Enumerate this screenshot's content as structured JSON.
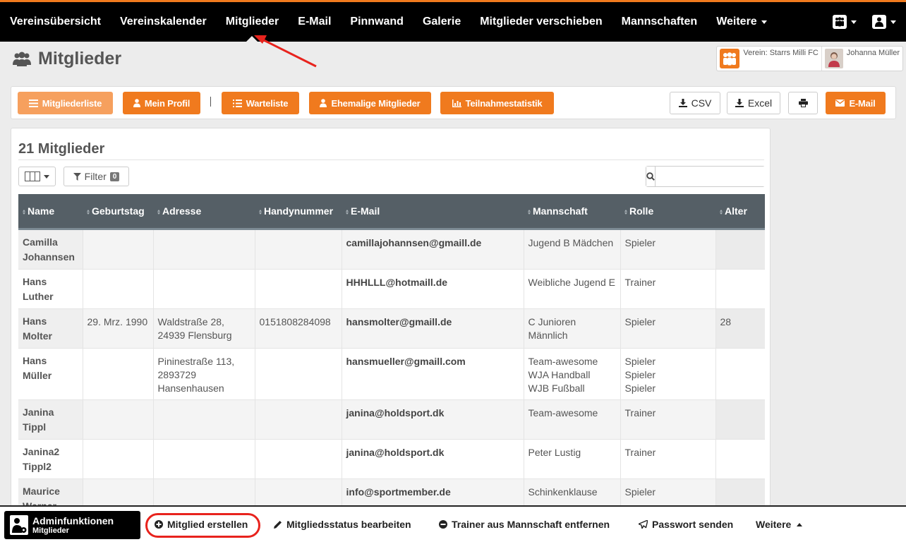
{
  "topnav": {
    "items": [
      "Vereinsübersicht",
      "Vereinskalender",
      "Mitglieder",
      "E-Mail",
      "Pinnwand",
      "Galerie",
      "Mitglieder verschieben",
      "Mannschaften",
      "Weitere"
    ],
    "active": "Mitglieder",
    "right_icons": [
      "team-icon",
      "user-icon"
    ]
  },
  "header": {
    "title": "Mitglieder",
    "club_label": "Verein: Starrs Milli FC",
    "user_name": "Johanna Müller"
  },
  "toolbar": {
    "member_list": "Mitgliederliste",
    "my_profile": "Mein Profil",
    "separator": "|",
    "waiting_list": "Warteliste",
    "former_members": "Ehemalige Mitglieder",
    "attendance_stats": "Teilnahmestatistik",
    "csv": "CSV",
    "excel": "Excel",
    "email": "E-Mail"
  },
  "members": {
    "count_title": "21 Mitglieder",
    "filter_label": "Filter",
    "filter_count": "0",
    "search_placeholder": "",
    "columns": [
      "Name",
      "Geburtstag",
      "Adresse",
      "Handynummer",
      "E-Mail",
      "Mannschaft",
      "Rolle",
      "Alter"
    ],
    "rows": [
      {
        "name": [
          "Camilla",
          "Johannsen"
        ],
        "birthday": "",
        "address": [],
        "phone": "",
        "email": "camillajohannsen@gmaill.de",
        "teams": [
          "Jugend B Mädchen"
        ],
        "roles": [
          "Spieler"
        ],
        "age": ""
      },
      {
        "name": [
          "Hans",
          "Luther"
        ],
        "birthday": "",
        "address": [],
        "phone": "",
        "email": "HHHLLL@hotmaill.de",
        "teams": [
          "Weibliche Jugend E"
        ],
        "roles": [
          "Trainer"
        ],
        "age": ""
      },
      {
        "name": [
          "Hans",
          "Molter"
        ],
        "birthday": "29. Mrz. 1990",
        "address": [
          "Waldstraße 28,",
          "24939 Flensburg"
        ],
        "phone": "0151808284098",
        "email": "hansmolter@gmaill.de",
        "teams": [
          "C Junioren Männlich"
        ],
        "roles": [
          "Spieler"
        ],
        "age": "28"
      },
      {
        "name": [
          "Hans",
          "Müller"
        ],
        "birthday": "",
        "address": [
          "Pininestraße 113,",
          "2893729",
          "Hansenhausen"
        ],
        "phone": "",
        "email": "hansmueller@gmaill.com",
        "teams": [
          "Team-awesome",
          "WJA Handball",
          "WJB Fußball"
        ],
        "roles": [
          "Spieler",
          "Spieler",
          "Spieler"
        ],
        "age": ""
      },
      {
        "name": [
          "Janina",
          "Tippl"
        ],
        "birthday": "",
        "address": [],
        "phone": "",
        "email": "janina@holdsport.dk",
        "teams": [
          "Team-awesome"
        ],
        "roles": [
          "Trainer"
        ],
        "age": ""
      },
      {
        "name": [
          "Janina2",
          "Tippl2"
        ],
        "birthday": "",
        "address": [],
        "phone": "",
        "email": "janina@holdsport.dk",
        "teams": [
          "Peter Lustig"
        ],
        "roles": [
          "Trainer"
        ],
        "age": ""
      },
      {
        "name": [
          "Maurice",
          "Werner"
        ],
        "birthday": "",
        "address": [],
        "phone": "",
        "email": "info@sportmember.de",
        "teams": [
          "Schinkenklause"
        ],
        "roles": [
          "Spieler"
        ],
        "age": ""
      }
    ]
  },
  "admin_bar": {
    "title": "Adminfunktionen",
    "subtitle": "Mitglieder",
    "create_member": "Mitglied erstellen",
    "edit_status": "Mitgliedsstatus bearbeiten",
    "remove_trainer": "Trainer aus Mannschaft entfernen",
    "send_password": "Passwort senden",
    "more": "Weitere"
  },
  "colors": {
    "accent": "#f07a1e",
    "accent_light": "#f6a05e",
    "nav_bg": "#000000",
    "table_header": "#555f66",
    "annotation": "#e8231d"
  }
}
